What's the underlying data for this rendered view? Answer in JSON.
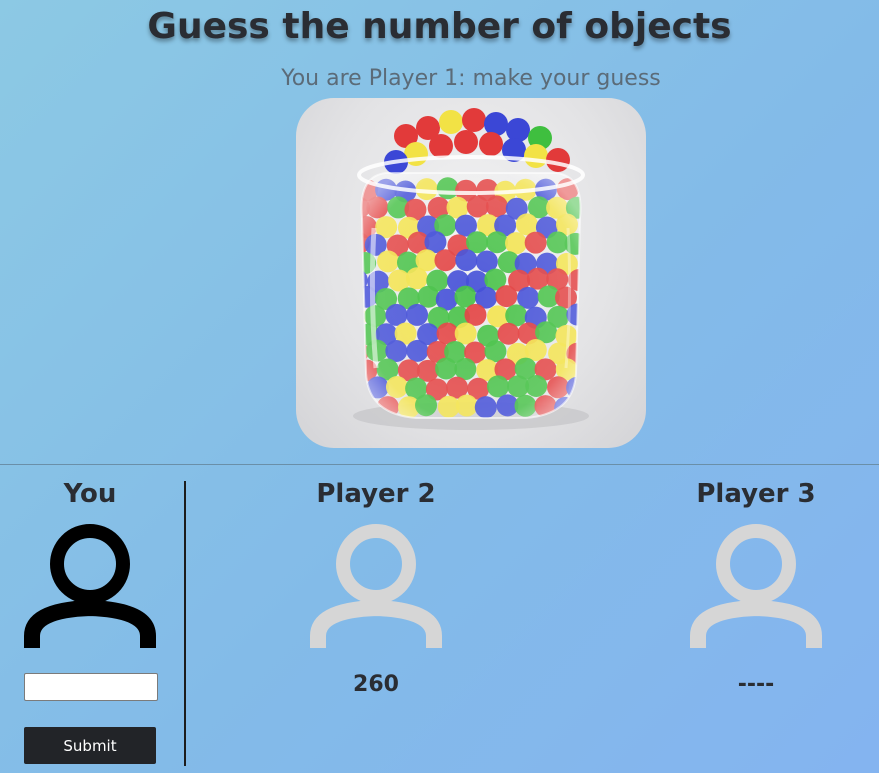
{
  "header": {
    "title": "Guess the number of objects",
    "subtitle": "You are Player 1: make your guess"
  },
  "image": {
    "alt": "Glass jar filled with red, green, blue and yellow balls",
    "ball_colors": [
      "#e23a3a",
      "#3fbf3f",
      "#3b47d6",
      "#f2e245"
    ]
  },
  "players": {
    "you": {
      "name": "You",
      "icon": "user-icon",
      "icon_color": "#000000",
      "guess_value": "",
      "guess_placeholder": "",
      "submit_label": "Submit"
    },
    "player2": {
      "name": "Player 2",
      "icon": "user-icon",
      "icon_color": "#d6d6d6",
      "guess": "260"
    },
    "player3": {
      "name": "Player 3",
      "icon": "user-icon",
      "icon_color": "#d6d6d6",
      "guess": "----"
    }
  }
}
